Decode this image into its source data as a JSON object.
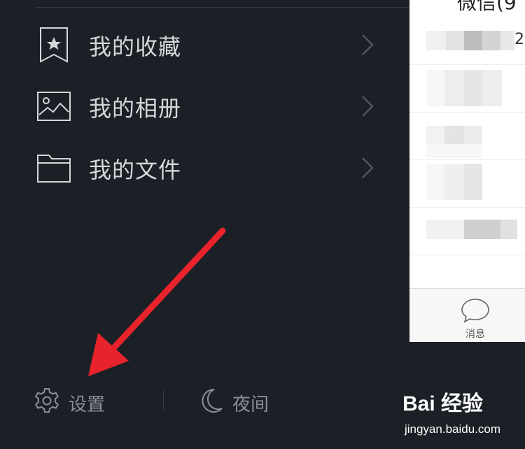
{
  "menu": {
    "items": [
      {
        "label": "我的收藏",
        "icon": "bookmark-star-icon"
      },
      {
        "label": "我的相册",
        "icon": "image-icon"
      },
      {
        "label": "我的文件",
        "icon": "folder-icon"
      }
    ]
  },
  "bottom_bar": {
    "settings_label": "设置",
    "settings_icon": "gear-icon",
    "night_label": "夜间",
    "night_icon": "moon-icon"
  },
  "chat_panel": {
    "header_partial_text": "微信(9",
    "row_tail_text": "2",
    "tab_label": "消息",
    "tab_icon": "chat-bubble-icon"
  },
  "annotation": {
    "arrow_color": "#e8232b",
    "arrow_target": "settings"
  },
  "watermark": {
    "brand": "Bai 经验",
    "url": "jingyan.baidu.com"
  },
  "colors": {
    "background": "#1b1f26",
    "menu_text": "#d4d6d9",
    "muted_text": "#8b9097"
  }
}
